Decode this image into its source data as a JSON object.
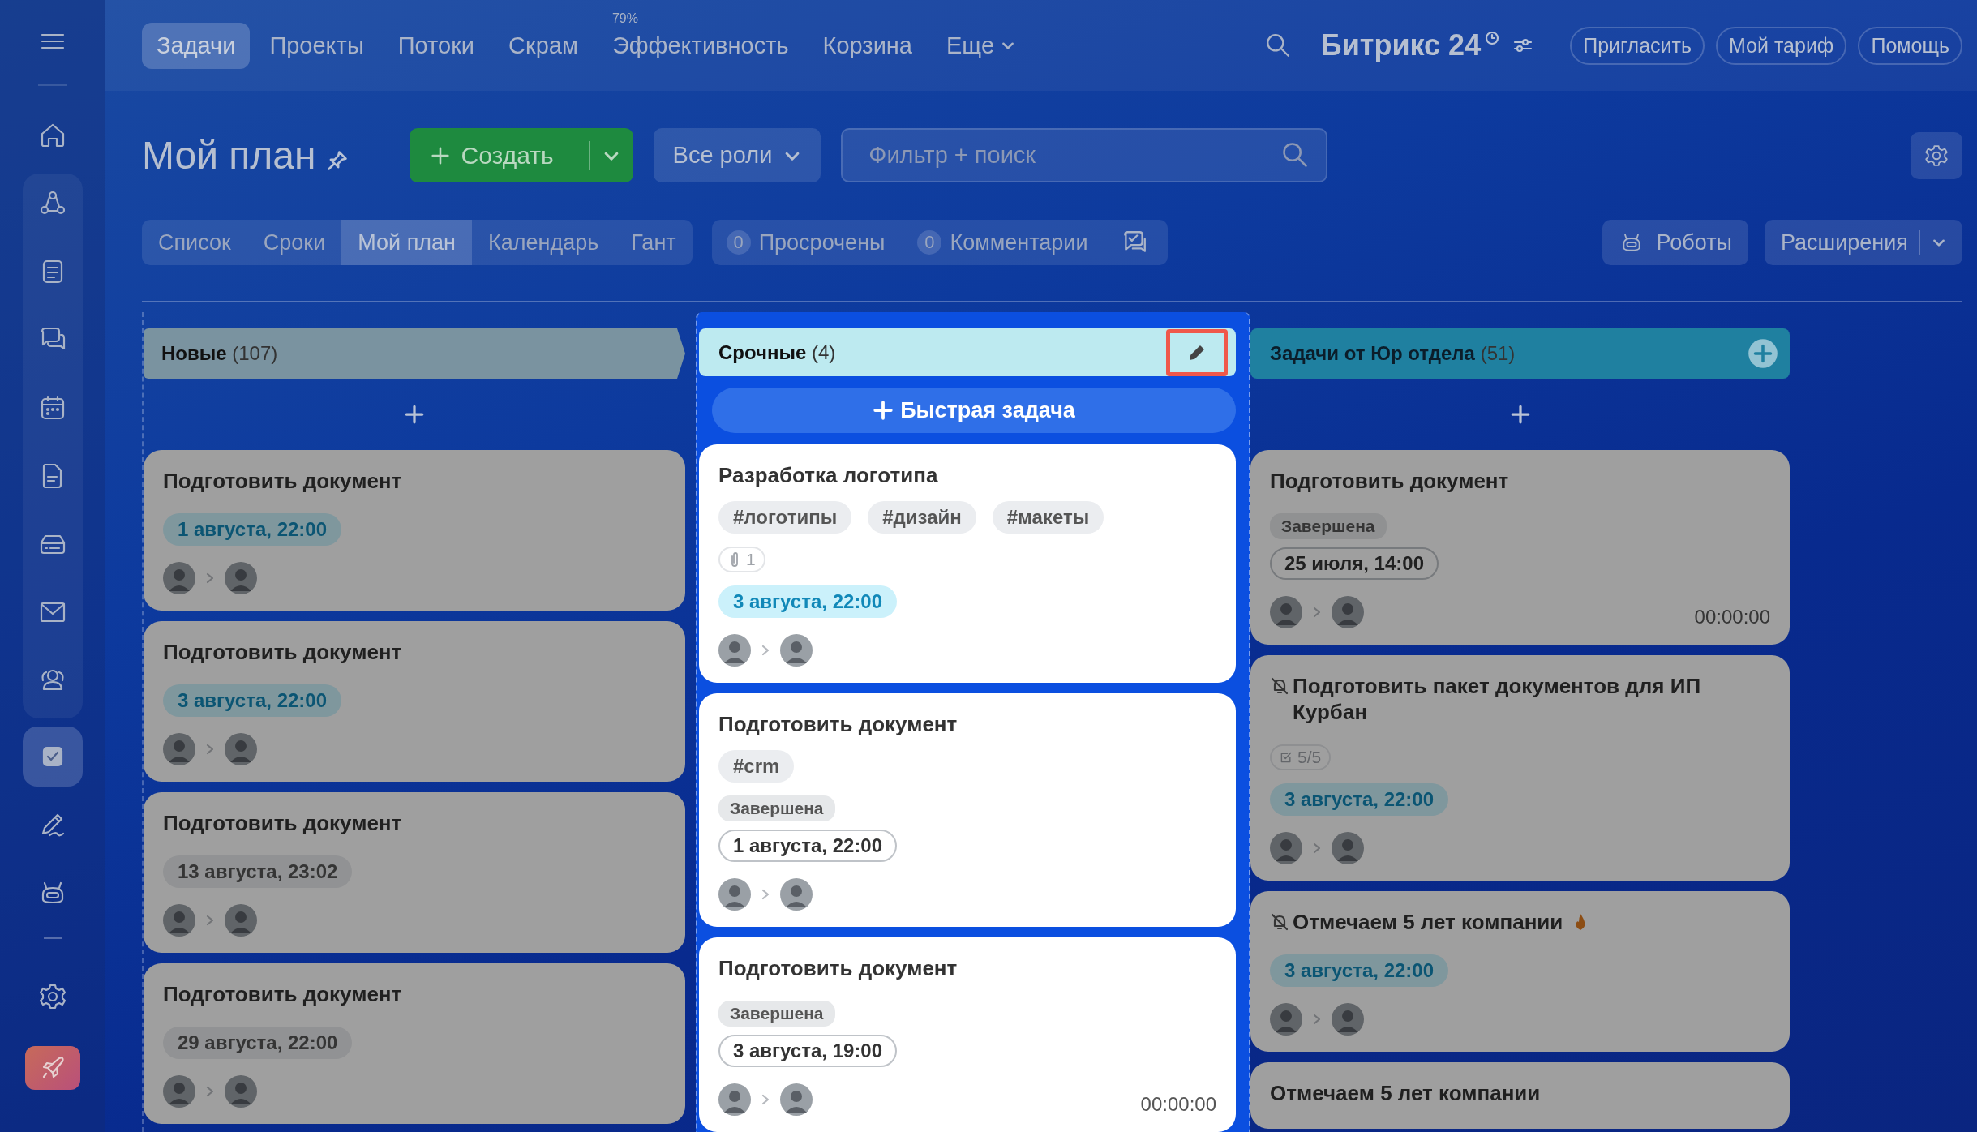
{
  "sidebar": {
    "sections": [
      {
        "kind": "plain",
        "items": [
          {
            "kind": "menu",
            "selected": false
          }
        ]
      },
      {
        "kind": "plain",
        "items": [
          {
            "kind": "home",
            "selected": false
          }
        ]
      },
      {
        "kind": "panel",
        "items": [
          {
            "kind": "flow",
            "selected": false
          },
          {
            "kind": "feed",
            "selected": false
          },
          {
            "kind": "chat",
            "selected": false
          },
          {
            "kind": "calendar",
            "selected": false
          },
          {
            "kind": "document",
            "selected": false
          },
          {
            "kind": "drive",
            "selected": false
          },
          {
            "kind": "mail",
            "selected": false
          },
          {
            "kind": "people",
            "selected": false
          }
        ]
      },
      {
        "kind": "plain",
        "items": [
          {
            "kind": "tasks",
            "selected": true
          },
          {
            "kind": "sign",
            "selected": false
          },
          {
            "kind": "robot",
            "selected": false
          }
        ]
      },
      {
        "kind": "footer",
        "items": [
          {
            "kind": "settings",
            "selected": false
          },
          {
            "kind": "rocket",
            "selected": false
          }
        ]
      }
    ]
  },
  "topnav": {
    "tabs": [
      {
        "label": "Задачи",
        "selected": true,
        "dropdown": false
      },
      {
        "label": "Проекты",
        "selected": false,
        "dropdown": false
      },
      {
        "label": "Потоки",
        "selected": false,
        "dropdown": false
      },
      {
        "label": "Скрам",
        "selected": false,
        "dropdown": false
      },
      {
        "label": "Эффективность",
        "selected": false,
        "dropdown": false,
        "badge": "79%"
      },
      {
        "label": "Корзина",
        "selected": false,
        "dropdown": false
      },
      {
        "label": "Еще",
        "selected": false,
        "dropdown": true
      }
    ],
    "brand": "Битрикс 24",
    "buttons": [
      "Пригласить",
      "Мой тариф",
      "Помощь"
    ]
  },
  "header": {
    "title": "Мой план",
    "create_button": "Создать",
    "roles_button": "Все роли",
    "search": {
      "placeholder": "Фильтр + поиск"
    }
  },
  "views": [
    {
      "label": "Список",
      "selected": false
    },
    {
      "label": "Сроки",
      "selected": false
    },
    {
      "label": "Мой план",
      "selected": true
    },
    {
      "label": "Календарь",
      "selected": false
    },
    {
      "label": "Гант",
      "selected": false
    }
  ],
  "counters": [
    {
      "count": "0",
      "label": "Просрочены"
    },
    {
      "count": "0",
      "label": "Комментарии"
    }
  ],
  "toolbar_buttons": [
    {
      "label": "Роботы",
      "kind": "robots"
    },
    {
      "label": "Расширения",
      "kind": "split"
    }
  ],
  "columns": [
    {
      "title": "Новые",
      "count": "(107)",
      "color": "#7a93a0",
      "kind": "arrow",
      "highlighted": false,
      "cards": [
        {
          "title": "Подготовить документ",
          "muted": false,
          "hot": false,
          "deadline": {
            "text": "1 августа, 22:00",
            "kind": "upcoming"
          },
          "people": true
        },
        {
          "title": "Подготовить документ",
          "muted": false,
          "hot": false,
          "deadline": {
            "text": "3 августа, 22:00",
            "kind": "upcoming"
          },
          "people": true
        },
        {
          "title": "Подготовить документ",
          "muted": false,
          "hot": false,
          "deadline": {
            "text": "13 августа, 23:02",
            "kind": "later"
          },
          "people": true
        },
        {
          "title": "Подготовить документ",
          "muted": false,
          "hot": false,
          "deadline": {
            "text": "29 августа, 22:00",
            "kind": "later"
          },
          "people": true
        }
      ]
    },
    {
      "title": "Срочные",
      "count": "(4)",
      "color": "#bdeaf0",
      "kind": "editing",
      "highlighted": true,
      "quick_task": "Быстрая задача",
      "cards": [
        {
          "title": "Разработка логотипа",
          "muted": false,
          "hot": false,
          "tags": [
            "#логотипы",
            "#дизайн",
            "#макеты"
          ],
          "attachments": "1",
          "deadline": {
            "text": "3 августа, 22:00",
            "kind": "upcoming"
          },
          "people": true
        },
        {
          "title": "Подготовить документ",
          "muted": false,
          "hot": false,
          "tags": [
            "#crm"
          ],
          "status": "Завершена",
          "deadline": {
            "text": "1 августа, 22:00",
            "kind": "done"
          },
          "people": true
        },
        {
          "title": "Подготовить документ",
          "muted": false,
          "hot": false,
          "status": "Завершена",
          "deadline": {
            "text": "3 августа, 19:00",
            "kind": "done"
          },
          "people": true,
          "timer": "00:00:00"
        }
      ]
    },
    {
      "title": "Задачи от Юр отдела",
      "count": "(51)",
      "color": "#1f80a0",
      "kind": "plain",
      "highlighted": false,
      "cards": [
        {
          "title": "Подготовить документ",
          "muted": false,
          "hot": false,
          "status": "Завершена",
          "deadline": {
            "text": "25 июля, 14:00",
            "kind": "done"
          },
          "people": true,
          "timer": "00:00:00"
        },
        {
          "title": "Подготовить пакет документов для ИП Курбан",
          "muted": true,
          "hot": false,
          "checklist": "5/5",
          "deadline": {
            "text": "3 августа, 22:00",
            "kind": "upcoming"
          },
          "people": true
        },
        {
          "title": "Отмечаем 5 лет компании",
          "muted": true,
          "hot": true,
          "deadline": {
            "text": "3 августа, 22:00",
            "kind": "upcoming"
          },
          "people": true
        },
        {
          "title": "Отмечаем 5 лет компании",
          "muted": false,
          "hot": false,
          "people": false
        }
      ]
    }
  ]
}
